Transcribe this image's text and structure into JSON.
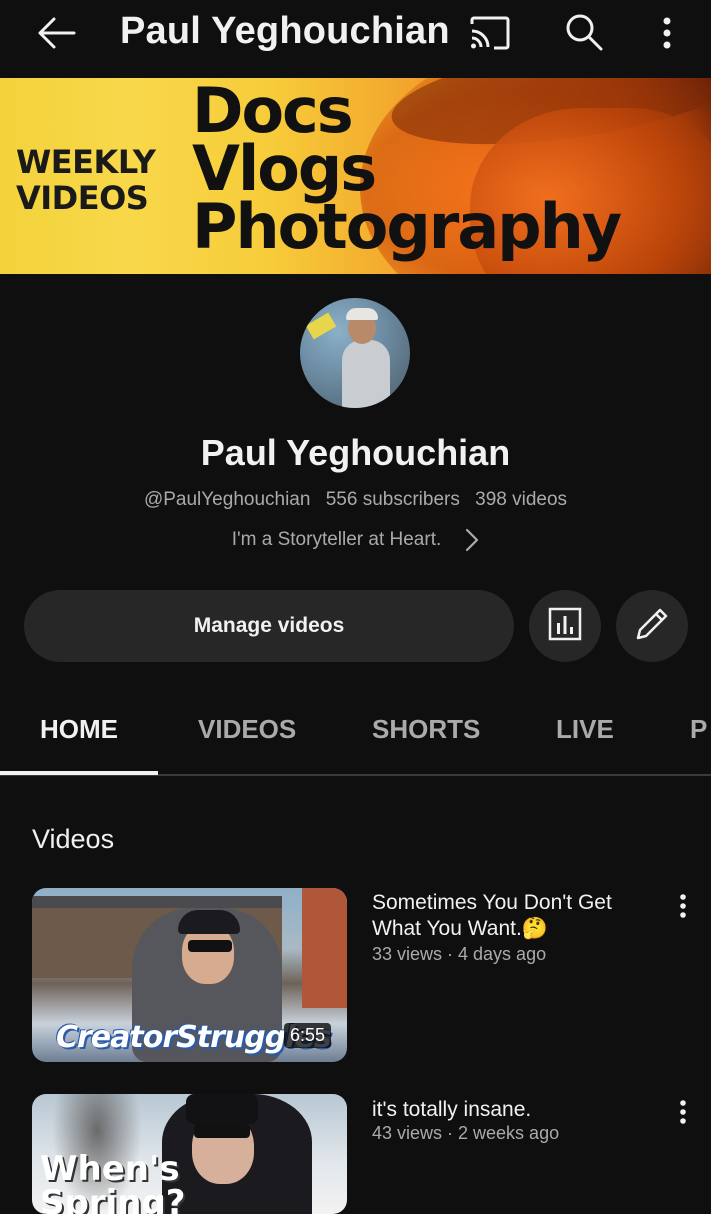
{
  "header": {
    "title": "Paul Yeghouchian",
    "icons": [
      "back-arrow-icon",
      "cast-icon",
      "search-icon",
      "more-vertical-icon"
    ]
  },
  "banner": {
    "left_text": "WEEKLY\nVIDEOS",
    "main_text": "Docs\nVlogs\nPhotography"
  },
  "channel": {
    "name": "Paul Yeghouchian",
    "handle": "@PaulYeghouchian",
    "subscribers": "556 subscribers",
    "videos": "398 videos",
    "description": "I'm a Storyteller at Heart."
  },
  "actions": {
    "manage_label": "Manage videos",
    "analytics_icon": "analytics-icon",
    "edit_icon": "pencil-icon"
  },
  "tabs": [
    {
      "label": "HOME",
      "active": true
    },
    {
      "label": "VIDEOS",
      "active": false
    },
    {
      "label": "SHORTS",
      "active": false
    },
    {
      "label": "LIVE",
      "active": false
    },
    {
      "label": "P",
      "active": false
    }
  ],
  "section": {
    "title": "Videos"
  },
  "videos": [
    {
      "title": "Sometimes You Don't Get What You Want.🤔",
      "meta": "33 views · 4 days ago",
      "thumb_text": "CreatorStruggles",
      "duration": "6:55"
    },
    {
      "title": "it's totally insane.",
      "meta": "43 views · 2 weeks ago",
      "thumb_text": "When's\nSpring?"
    }
  ],
  "colors": {
    "background": "#0f0f0f",
    "surface": "#272727",
    "text_primary": "#f1f1f1",
    "text_secondary": "#aaaaaa"
  }
}
